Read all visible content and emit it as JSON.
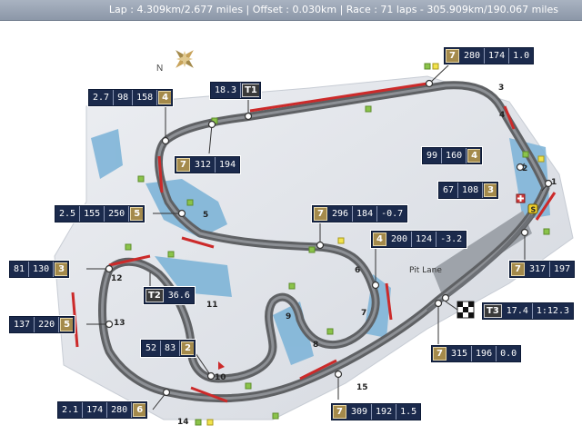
{
  "header": {
    "info": "Lap : 4.309km/2.677 miles  |  Offset : 0.030km  |  Race : 71 laps - 305.909km/190.067 miles"
  },
  "compass": {
    "north_label": "N"
  },
  "pit_lane_label": "Pit Lane",
  "turns": [
    "1",
    "2",
    "3",
    "4",
    "5",
    "6",
    "7",
    "8",
    "9",
    "10",
    "11",
    "12",
    "13",
    "14",
    "15"
  ],
  "markers": {
    "s_badge": "S"
  },
  "info_boxes": {
    "b_t3": {
      "cells": [
        "7",
        "280",
        "174",
        "1.0"
      ]
    },
    "b_t4top": {
      "cells": [
        "2.7",
        "98",
        "158",
        "4"
      ]
    },
    "b_t1": {
      "cells": [
        "18.3",
        "T1"
      ]
    },
    "b_t4b": {
      "cells": [
        "7",
        "312",
        "194"
      ]
    },
    "b_t2": {
      "cells": [
        "99",
        "160",
        "4"
      ]
    },
    "b_t1b": {
      "cells": [
        "67",
        "108",
        "3"
      ]
    },
    "b_t5": {
      "cells": [
        "2.5",
        "155",
        "250",
        "5"
      ]
    },
    "b_t6": {
      "cells": [
        "7",
        "296",
        "184",
        "-0.7"
      ]
    },
    "b_t7": {
      "cells": [
        "4",
        "200",
        "124",
        "-3.2"
      ]
    },
    "b_pit": {
      "cells": [
        "7",
        "317",
        "197"
      ]
    },
    "b_t12": {
      "cells": [
        "81",
        "130",
        "3"
      ]
    },
    "b_t2sec": {
      "cells": [
        "T2",
        "36.6"
      ]
    },
    "b_t13": {
      "cells": [
        "137",
        "220",
        "5"
      ]
    },
    "b_t10": {
      "cells": [
        "52",
        "83",
        "2"
      ]
    },
    "b_t3sec": {
      "cells": [
        "T3",
        "17.4",
        "1:12.3"
      ]
    },
    "b_t15": {
      "cells": [
        "7",
        "315",
        "196",
        "0.0"
      ]
    },
    "b_t14": {
      "cells": [
        "2.1",
        "174",
        "280",
        "6"
      ]
    },
    "b_fin": {
      "cells": [
        "7",
        "309",
        "192",
        "1.5"
      ]
    }
  },
  "colors": {
    "track": "#5f6164",
    "water": "#7fb5d8",
    "kerb": "#cc2a2a",
    "gear_badge": "#a48a4b",
    "box_bg": "#1b2a4c"
  }
}
